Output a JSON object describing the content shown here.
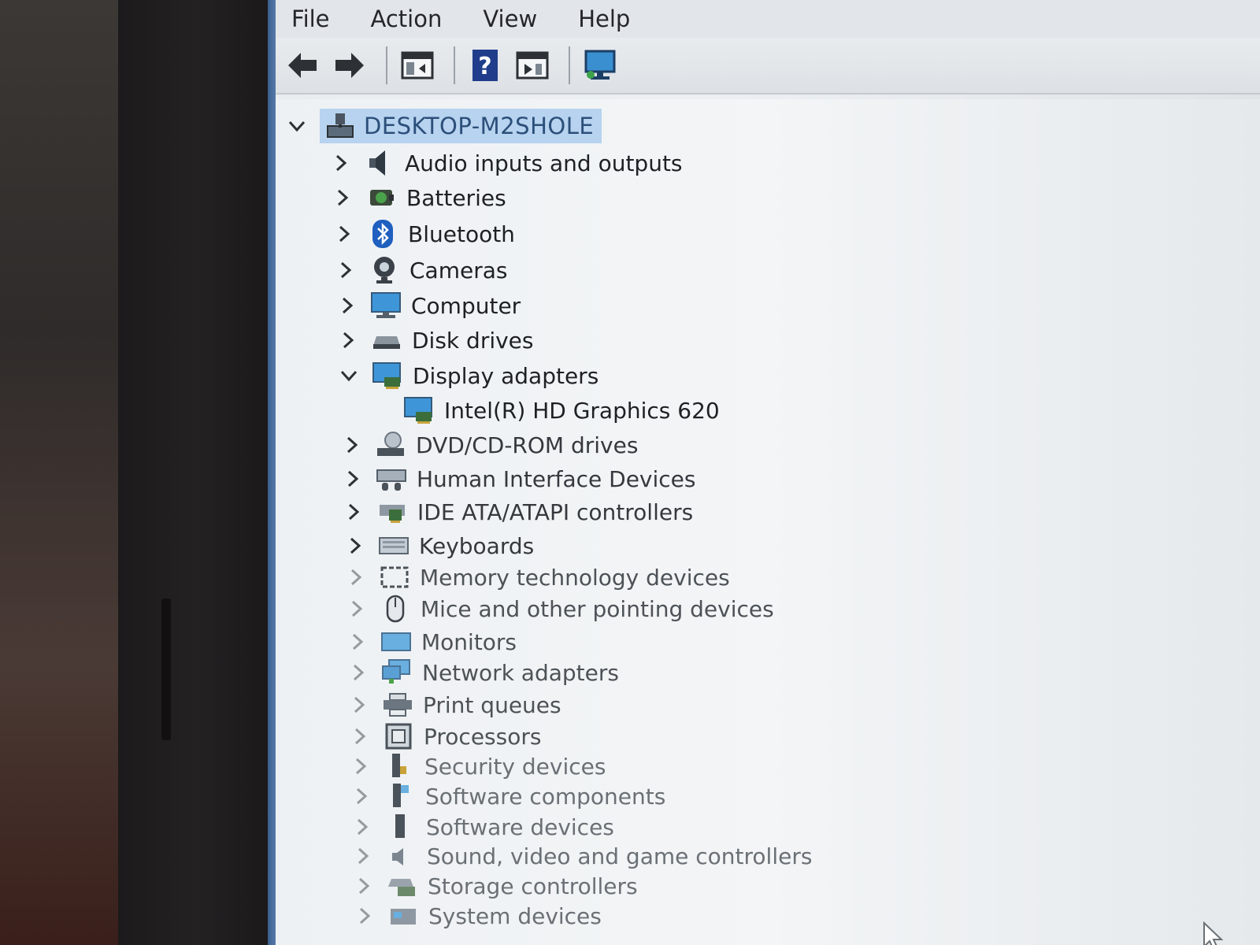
{
  "menu": [
    "File",
    "Action",
    "View",
    "Help"
  ],
  "toolbar": {
    "icons": [
      "back-arrow-icon",
      "forward-arrow-icon",
      "properties-window-icon",
      "help-icon",
      "update-driver-icon",
      "scan-hardware-monitor-icon"
    ]
  },
  "tree": {
    "root": "DESKTOP-M2SHOLE",
    "items": [
      {
        "label": "Audio inputs and outputs",
        "icon": "speaker-icon",
        "expanded": false
      },
      {
        "label": "Batteries",
        "icon": "battery-icon",
        "expanded": false
      },
      {
        "label": "Bluetooth",
        "icon": "bluetooth-icon",
        "expanded": false
      },
      {
        "label": "Cameras",
        "icon": "camera-icon",
        "expanded": false
      },
      {
        "label": "Computer",
        "icon": "computer-monitor-icon",
        "expanded": false
      },
      {
        "label": "Disk drives",
        "icon": "disk-drive-icon",
        "expanded": false
      },
      {
        "label": "Display adapters",
        "icon": "display-adapter-icon",
        "expanded": true
      },
      {
        "label": "Intel(R) HD Graphics 620",
        "icon": "display-adapter-icon",
        "child": true
      },
      {
        "label": "DVD/CD-ROM drives",
        "icon": "dvd-drive-icon",
        "expanded": false
      },
      {
        "label": "Human Interface Devices",
        "icon": "hid-icon",
        "expanded": false
      },
      {
        "label": "IDE ATA/ATAPI controllers",
        "icon": "ide-controller-icon",
        "expanded": false
      },
      {
        "label": "Keyboards",
        "icon": "keyboard-icon",
        "expanded": false
      },
      {
        "label": "Memory technology devices",
        "icon": "memory-device-icon",
        "expanded": false
      },
      {
        "label": "Mice and other pointing devices",
        "icon": "mouse-icon",
        "expanded": false
      },
      {
        "label": "Monitors",
        "icon": "monitor-icon",
        "expanded": false
      },
      {
        "label": "Network adapters",
        "icon": "network-adapter-icon",
        "expanded": false
      },
      {
        "label": "Print queues",
        "icon": "printer-icon",
        "expanded": false
      },
      {
        "label": "Processors",
        "icon": "processor-icon",
        "expanded": false
      },
      {
        "label": "Security devices",
        "icon": "security-device-icon",
        "expanded": false
      },
      {
        "label": "Software components",
        "icon": "software-component-icon",
        "expanded": false
      },
      {
        "label": "Software devices",
        "icon": "software-device-icon",
        "expanded": false
      },
      {
        "label": "Sound, video and game controllers",
        "icon": "sound-controller-icon",
        "expanded": false
      },
      {
        "label": "Storage controllers",
        "icon": "storage-controller-icon",
        "expanded": false
      },
      {
        "label": "System devices",
        "icon": "system-device-icon",
        "expanded": false
      }
    ]
  },
  "colors": {
    "selection": "#b7d3ef",
    "window_bg": "#eef1f4",
    "menu_bg": "#e2e6ea",
    "text": "#1e2124"
  }
}
